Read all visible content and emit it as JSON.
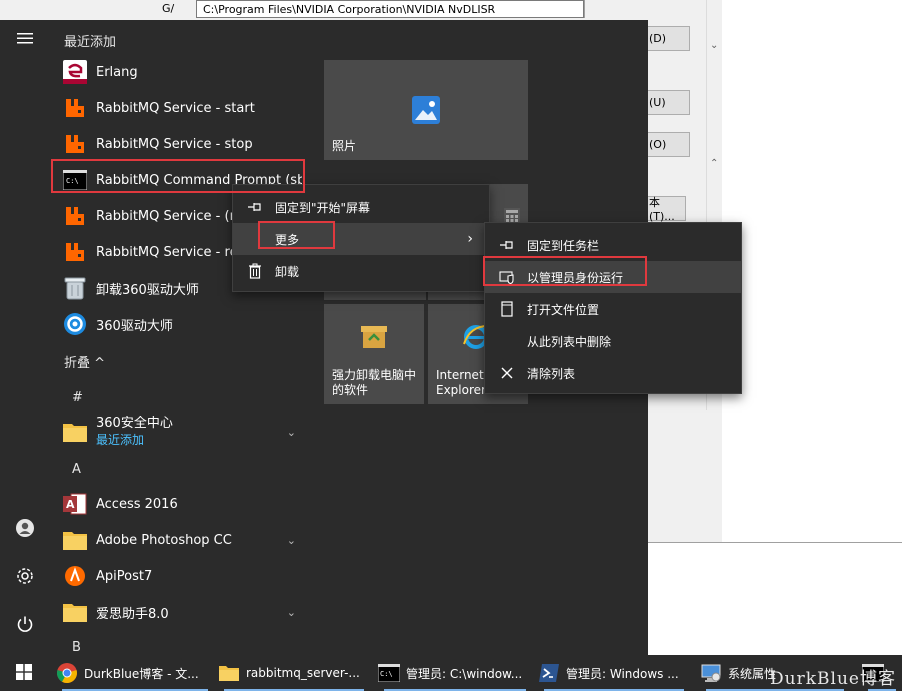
{
  "background_window": {
    "top_field_text": "C:\\Program Files\\NVIDIA Corporation\\NVIDIA NvDLISR",
    "gutter_text": "G/",
    "buttons": [
      "(D)",
      "(U)",
      "(O)",
      "本(T)..."
    ],
    "top_right_text": "^"
  },
  "start_menu": {
    "recent_header": "最近添加",
    "apps_recent": [
      {
        "label": "Erlang",
        "icon": "erlang-icon"
      },
      {
        "label": "RabbitMQ Service - start",
        "icon": "rabbitmq-icon"
      },
      {
        "label": "RabbitMQ Service - stop",
        "icon": "rabbitmq-icon"
      },
      {
        "label": "RabbitMQ Command Prompt (sbin dir)",
        "icon": "cmd-icon"
      },
      {
        "label": "RabbitMQ Service - (re)install",
        "icon": "rabbitmq-icon"
      },
      {
        "label": "RabbitMQ Service - remove",
        "icon": "rabbitmq-icon"
      },
      {
        "label": "卸载360驱动大师",
        "icon": "recycle-bin-icon"
      },
      {
        "label": "360驱动大师",
        "icon": "360-driver-icon"
      }
    ],
    "collapse_label": "折叠 ^",
    "group_hash": "#",
    "folder_360": {
      "label": "360安全中心",
      "sub": "最近添加"
    },
    "group_a": "A",
    "apps_a": [
      {
        "label": "Access 2016",
        "icon": "access-icon"
      },
      {
        "label": "Adobe Photoshop CC",
        "icon": "folder-icon"
      },
      {
        "label": "ApiPost7",
        "icon": "apipost-icon"
      },
      {
        "label": "爱思助手8.0",
        "icon": "folder-icon"
      }
    ],
    "group_b": "B",
    "tiles": {
      "photos": "照片",
      "uninstall": "强力卸载电脑中\n的软件",
      "ie": "Internet\nExplorer"
    }
  },
  "context_menu": {
    "items": [
      "固定到\"开始\"屏幕",
      "更多",
      "卸载"
    ]
  },
  "submenu": {
    "items": [
      "固定到任务栏",
      "以管理员身份运行",
      "打开文件位置",
      "从此列表中删除",
      "清除列表"
    ]
  },
  "taskbar": {
    "items": [
      {
        "label": "DurkBlue博客 - 文...",
        "icon": "chrome-icon"
      },
      {
        "label": "rabbitmq_server-...",
        "icon": "folder-icon"
      },
      {
        "label": "管理员: C:\\window...",
        "icon": "cmd-icon"
      },
      {
        "label": "管理员: Windows ...",
        "icon": "powershell-icon"
      },
      {
        "label": "系统属性",
        "icon": "system-properties-icon"
      }
    ],
    "watermark": "DurkBlue博客"
  },
  "colors": {
    "start_bg": "#2b2b2b",
    "highlight_red": "#e0393e",
    "accent_blue": "#4cc2ff",
    "tile_bg": "#4a4a4a"
  }
}
